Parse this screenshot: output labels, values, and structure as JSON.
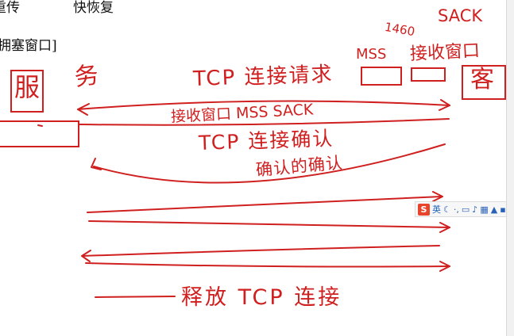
{
  "printed": {
    "retransmit": "重传",
    "fast_recovery": "快恢复",
    "congestion_window": "拥塞窗口]"
  },
  "handwriting": {
    "server": "服",
    "server_suffix": "务",
    "client": "客",
    "tcp_conn_request": "TCP 连接请求",
    "mss": "MSS",
    "mss_value": "1460",
    "sack": "SACK",
    "recv_window": "接收窗口",
    "reply_fields": "接收窗口 MSS SACK",
    "tcp_conn_confirm": "TCP 连接确认",
    "confirm_confirm": "确认的确认",
    "release_tcp": "释放 TCP 连接"
  },
  "ime_toolbar": {
    "logo": "S",
    "label": "英",
    "icons": [
      "moon-icon",
      "punct-icon",
      "keyboard-icon",
      "mic-icon",
      "grid-icon",
      "shirt-icon",
      "tools-icon"
    ]
  },
  "colors": {
    "ink": "#d01f1f",
    "print": "#111111"
  }
}
